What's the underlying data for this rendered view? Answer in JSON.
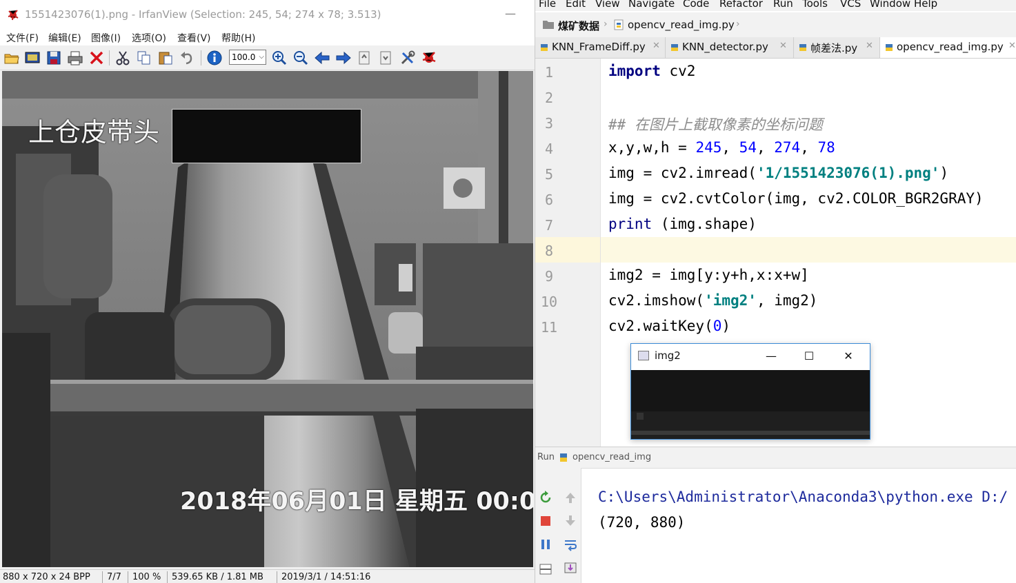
{
  "irfanview": {
    "title": "1551423076(1).png - IrfanView (Selection: 245, 54; 274 x 78; 3.513)",
    "menu": [
      "文件(F)",
      "编辑(E)",
      "图像(I)",
      "选项(O)",
      "查看(V)",
      "帮助(H)"
    ],
    "zoom_value": "100.0",
    "overlay_label": "上仓皮带头",
    "timestamp_overlay": "2018年06月01日  星期五  00:0",
    "status": {
      "dimensions": "880 x 720 x 24 BPP",
      "index": "7/7",
      "zoom": "100 %",
      "size": "539.65 KB / 1.81 MB",
      "date": "2019/3/1 / 14:51:16"
    }
  },
  "pycharm": {
    "menu": [
      "File",
      "Edit",
      "View",
      "Navigate",
      "Code",
      "Refactor",
      "Run",
      "Tools",
      "VCS",
      "Window",
      "Help"
    ],
    "breadcrumb": {
      "project": "煤矿数据",
      "file": "opencv_read_img.py"
    },
    "tabs": [
      "KNN_FrameDiff.py",
      "KNN_detector.py",
      "帧差法.py",
      "opencv_read_img.py"
    ],
    "active_tab": "opencv_read_img.py",
    "line_numbers": [
      "1",
      "2",
      "3",
      "4",
      "5",
      "6",
      "7",
      "8",
      "9",
      "10",
      "11"
    ],
    "code": {
      "l1_kw": "import",
      "l1_rest": " cv2",
      "l3": "## 在图片上截取像素的坐标问题",
      "l4_vars": "x,y,w,h = ",
      "l4_n1": "245",
      "l4_n2": "54",
      "l4_n3": "274",
      "l4_n4": "78",
      "l5_pre": "img = cv2.imread(",
      "l5_str": "'1/1551423076(1).png'",
      "l5_post": ")",
      "l6": "img = cv2.cvtColor(img, cv2.COLOR_BGR2GRAY)",
      "l7_kw": "print",
      "l7_rest": " (img.shape)",
      "l9": "img2 = img[y:y+h,x:x+w]",
      "l10_pre": "cv2.imshow(",
      "l10_str": "'img2'",
      "l10_post": ", img2)",
      "l11_pre": "cv2.waitKey(",
      "l11_num": "0",
      "l11_post": ")"
    },
    "img2_window": {
      "title": "img2",
      "minimize": "—",
      "maximize": "☐",
      "close": "✕"
    },
    "run": {
      "label": "Run",
      "config": "opencv_read_img",
      "output_line1": "C:\\Users\\Administrator\\Anaconda3\\python.exe D:/",
      "output_line2": "(720, 880)"
    }
  }
}
